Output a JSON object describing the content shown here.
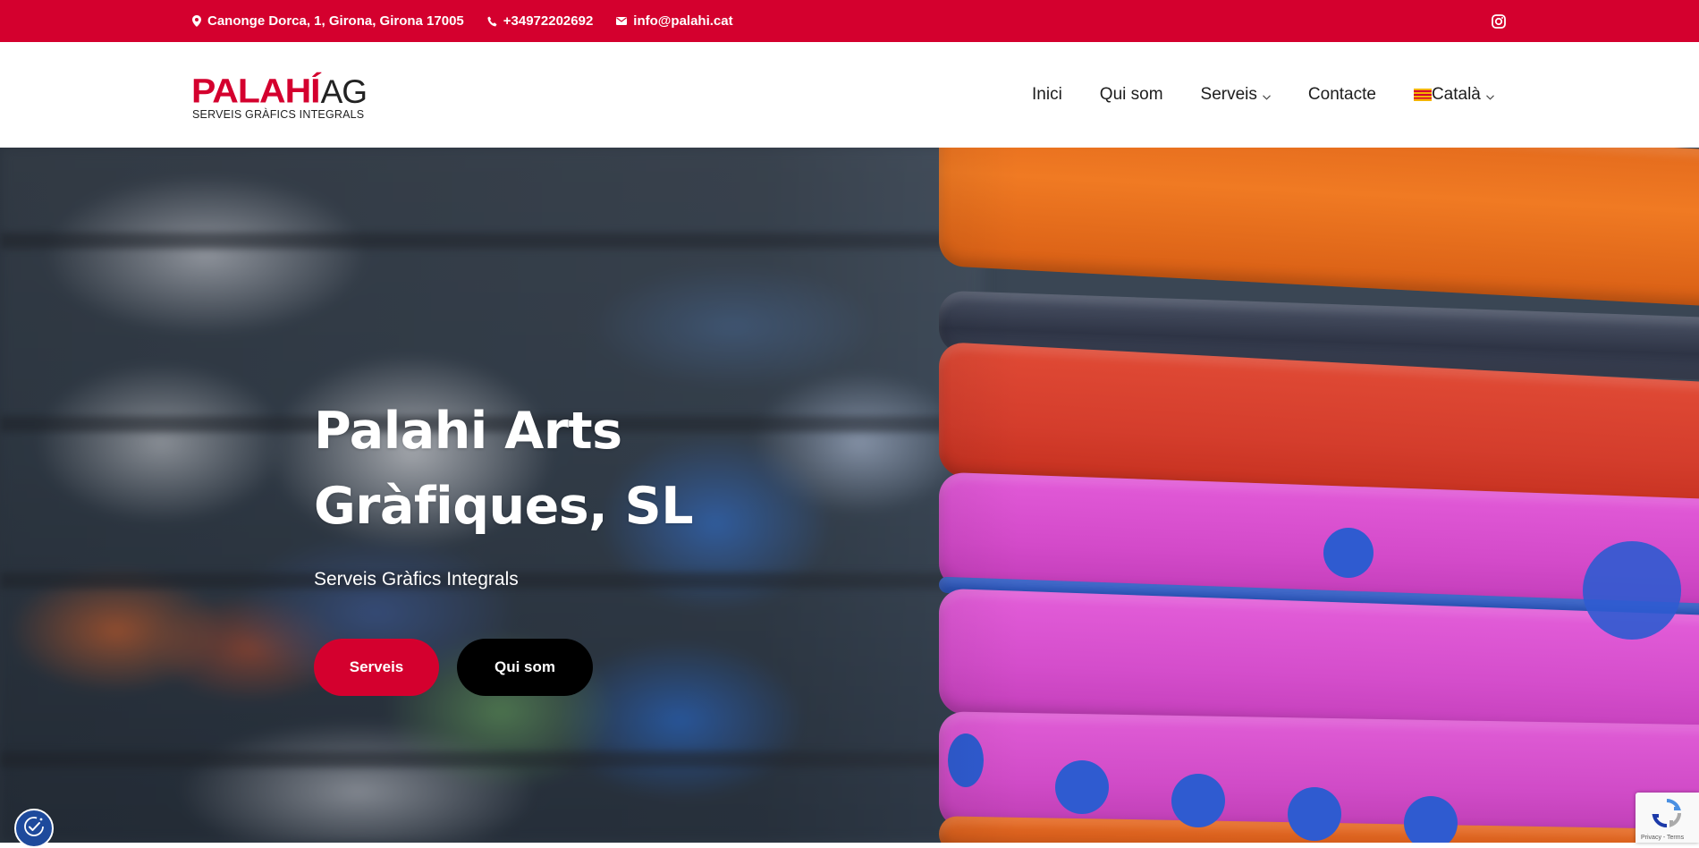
{
  "topbar": {
    "address": "Canonge Dorca, 1, Girona, Girona 17005",
    "phone": "+34972202692",
    "email": "info@palahi.cat",
    "social_icon": "instagram-icon",
    "background_color": "#d4002e"
  },
  "header": {
    "logo": {
      "brand": "PALAHÍ",
      "suffix": "AG",
      "tagline": "SERVEIS GRÀFICS INTEGRALS"
    },
    "nav": {
      "items": [
        {
          "label": "Inici"
        },
        {
          "label": "Qui som"
        },
        {
          "label": "Serveis",
          "dropdown": true
        },
        {
          "label": "Contacte"
        },
        {
          "label": "Català",
          "dropdown": true,
          "icon": "catalan-flag-icon"
        }
      ]
    }
  },
  "hero": {
    "title_line1": "Palahi Arts",
    "title_line2": "Gràfiques, SL",
    "subtitle": "Serveis Gràfics Integrals",
    "buttons": {
      "primary_label": "Serveis",
      "secondary_label": "Qui som"
    }
  },
  "widgets": {
    "accessibility_icon": "accessibility-icon",
    "recaptcha_terms": "Privacy - Terms"
  },
  "colors": {
    "accent": "#d4002e",
    "secondary_button": "#000000"
  }
}
